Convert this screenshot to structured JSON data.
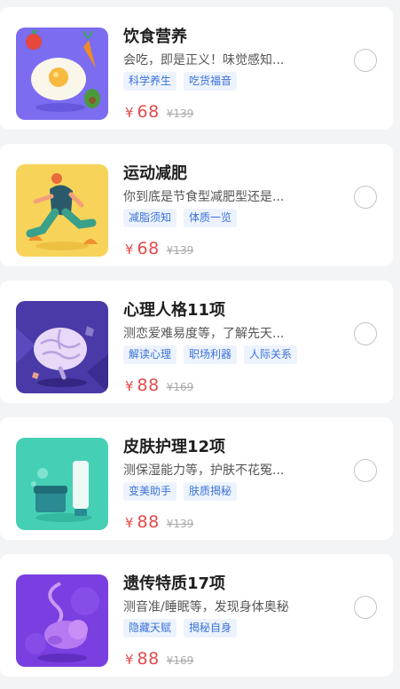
{
  "courses": [
    {
      "title": "饮食营养",
      "description": "会吃，即是正义！味觉感知...",
      "tags": [
        "科学养生",
        "吃货福音"
      ],
      "currency": "¥",
      "price": "68",
      "original_price": "¥139",
      "thumb_color": "#7b6cf0",
      "icon": "fried-egg-icon"
    },
    {
      "title": "运动减肥",
      "description": "你到底是节食型减肥型还是...",
      "tags": [
        "减脂须知",
        "体质一览"
      ],
      "currency": "¥",
      "price": "68",
      "original_price": "¥139",
      "thumb_color": "#f8d35a",
      "icon": "running-person-icon"
    },
    {
      "title": "心理人格11项",
      "description": "测恋爱难易度等，了解先天...",
      "tags": [
        "解读心理",
        "职场利器",
        "人际关系"
      ],
      "currency": "¥",
      "price": "88",
      "original_price": "¥169",
      "thumb_color": "#4a3aa8",
      "icon": "brain-icon"
    },
    {
      "title": "皮肤护理12项",
      "description": "测保湿能力等，护肤不花冤...",
      "tags": [
        "变美助手",
        "肤质揭秘"
      ],
      "currency": "¥",
      "price": "88",
      "original_price": "¥139",
      "thumb_color": "#45d0b6",
      "icon": "skincare-icon"
    },
    {
      "title": "遗传特质17项",
      "description": "测音准/睡眠等，发现身体奥秘",
      "tags": [
        "隐藏天赋",
        "揭秘自身"
      ],
      "currency": "¥",
      "price": "88",
      "original_price": "¥169",
      "thumb_color": "#7a3fe0",
      "icon": "embryo-icon"
    }
  ],
  "colors": {
    "price": "#e24b4b",
    "tag_text": "#3a72d8",
    "tag_background": "#edf3fd",
    "page_background": "#f3f4f6"
  }
}
